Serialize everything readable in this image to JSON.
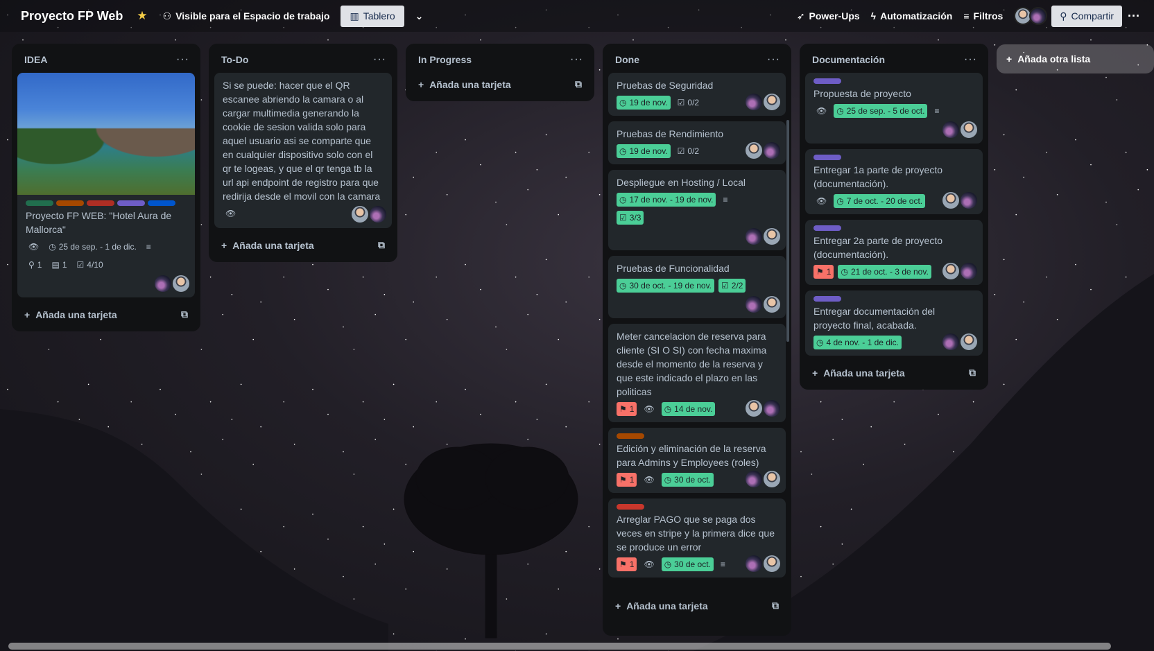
{
  "header": {
    "board_title": "Proyecto FP Web",
    "visibility_label": "Visible para el Espacio de trabajo",
    "view_label": "Tablero",
    "powerups_label": "Power-Ups",
    "automation_label": "Automatización",
    "filters_label": "Filtros",
    "share_label": "Compartir"
  },
  "add_card_label": "Añada una tarjeta",
  "add_list_label": "Añada otra lista",
  "lists": {
    "idea": {
      "title": "IDEA",
      "card": {
        "labels": [
          "#216e4e",
          "#a54800",
          "#ae2e24",
          "#6e5dc6",
          "#0055cc"
        ],
        "title": "Proyecto FP WEB: \"Hotel Aura de Mallorca\"",
        "dates": "25 de sep. - 1 de dic.",
        "attachments": "1",
        "boards": "1",
        "checklist": "4/10"
      }
    },
    "todo": {
      "title": "To-Do",
      "card": {
        "title": "Si se puede: hacer que el QR escanee abriendo la camara o al cargar multimedia generando la cookie de sesion valida solo para aquel usuario asi se comparte que en cualquier dispositivo solo con el qr te logeas, y que el qr tenga tb la url api endpoint de registro para que redirija desde el movil con la camara"
      }
    },
    "inprogress": {
      "title": "In Progress"
    },
    "done": {
      "title": "Done",
      "cards": [
        {
          "title": "Pruebas de Seguridad",
          "date": "19 de nov.",
          "checklist": "0/2"
        },
        {
          "title": "Pruebas de Rendimiento",
          "date": "19 de nov.",
          "checklist": "0/2"
        },
        {
          "title": "Despliegue en Hosting / Local",
          "date": "17 de nov. - 19 de nov.",
          "checklist": "3/3"
        },
        {
          "title": "Pruebas de Funcionalidad",
          "date": "30 de oct. - 19 de nov.",
          "checklist": "2/2"
        },
        {
          "title": "Meter cancelacion de reserva para cliente (SI O SI) con fecha maxima desde el momento de la reserva y que este indicado el plazo en las politicas",
          "pins": "1",
          "date": "14 de nov."
        },
        {
          "title": "Edición y eliminación de la reserva para Admins y Employees (roles)",
          "pins": "1",
          "date": "30 de oct.",
          "label": "#a54800"
        },
        {
          "title": "Arreglar PAGO que se paga dos veces en stripe y la primera dice que se produce un error",
          "pins": "1",
          "date": "30 de oct.",
          "label": "#c9372c"
        }
      ]
    },
    "docs": {
      "title": "Documentación",
      "cards": [
        {
          "title": "Propuesta de proyecto",
          "date": "25 de sep. - 5 de oct."
        },
        {
          "title": "Entregar 1a parte de proyecto (documentación).",
          "date": "7 de oct. - 20 de oct."
        },
        {
          "title": "Entregar 2a parte de proyecto (documentación).",
          "pins": "1",
          "date": "21 de oct. - 3 de nov."
        },
        {
          "title": "Entregar documentación del proyecto final, acabada.",
          "date": "4 de nov. - 1 de dic."
        }
      ],
      "label_color": "#6e5dc6"
    }
  }
}
